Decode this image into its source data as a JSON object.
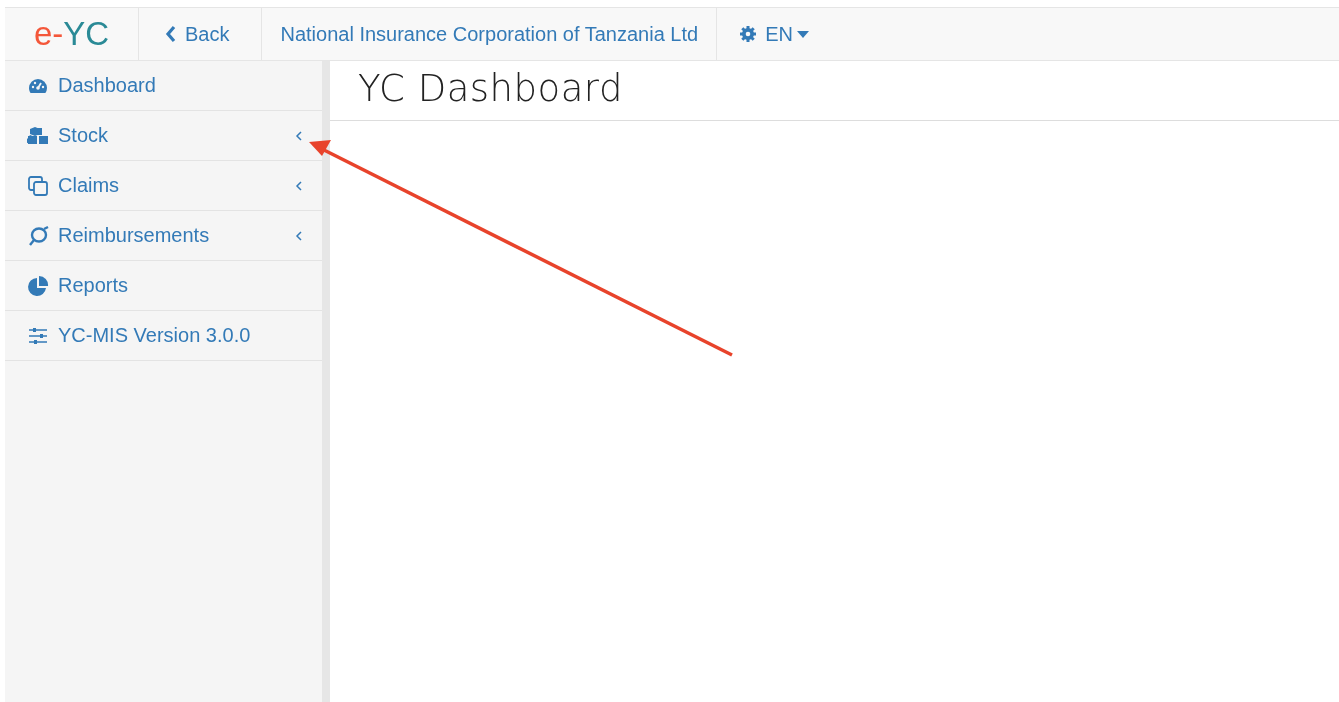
{
  "brand": {
    "prefix": "e-",
    "name": "YC"
  },
  "topbar": {
    "back": "Back",
    "organization": "National Insurance Corporation of Tanzania Ltd",
    "language": "EN"
  },
  "sidebar": {
    "items": [
      {
        "label": "Dashboard",
        "has_submenu": false
      },
      {
        "label": "Stock",
        "has_submenu": true
      },
      {
        "label": "Claims",
        "has_submenu": true
      },
      {
        "label": "Reimbursements",
        "has_submenu": true
      },
      {
        "label": "Reports",
        "has_submenu": false
      },
      {
        "label": "YC-MIS Version 3.0.0",
        "has_submenu": false
      }
    ]
  },
  "page": {
    "title": "YC Dashboard"
  },
  "annotation": {
    "kind": "arrow",
    "color": "#e8432b"
  }
}
